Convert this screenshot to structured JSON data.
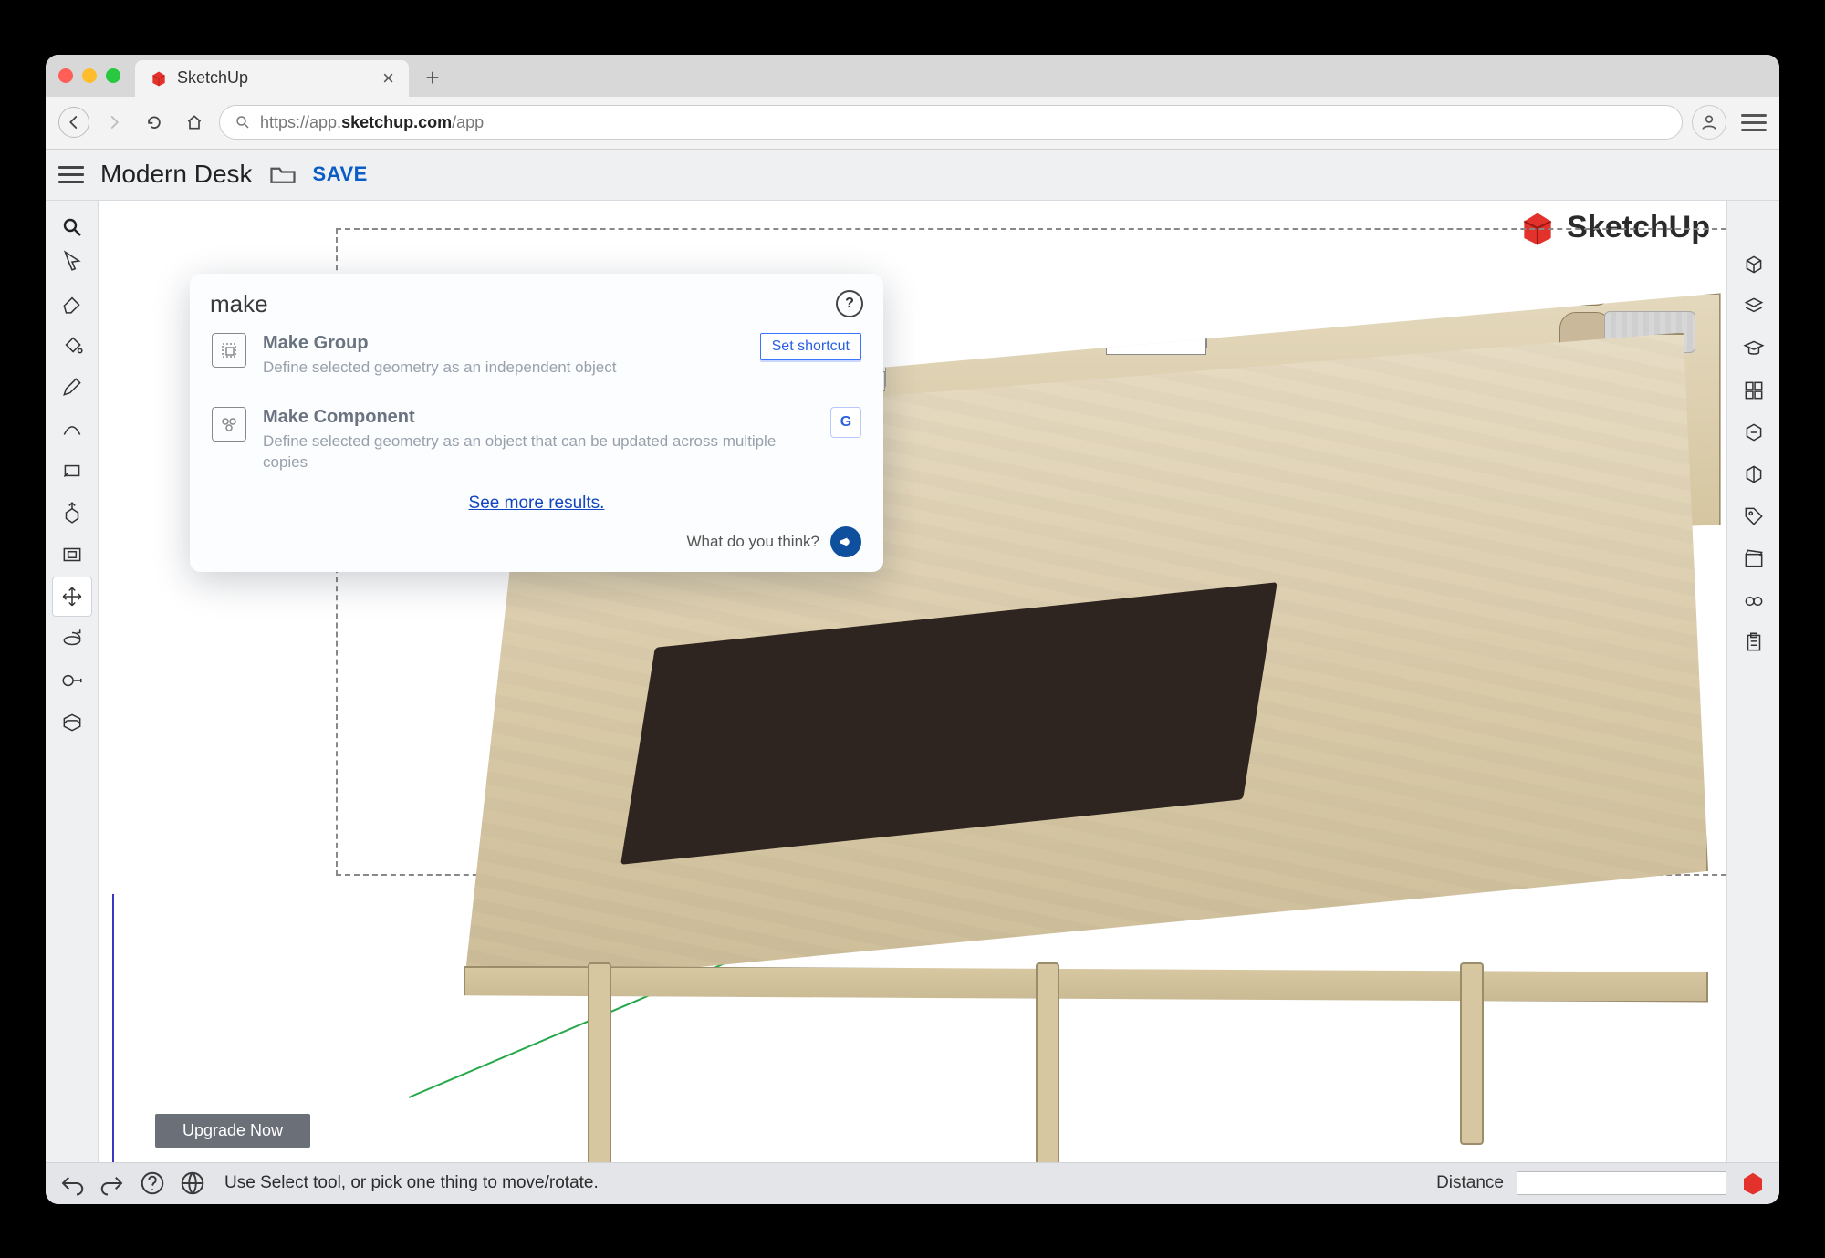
{
  "browser": {
    "tab_title": "SketchUp",
    "url_prefix": "https://app.",
    "url_bold": "sketchup.com",
    "url_suffix": "/app"
  },
  "header": {
    "title": "Modern Desk",
    "save": "SAVE"
  },
  "logo_text": "SketchUp",
  "search": {
    "query": "make",
    "results": [
      {
        "title": "Make Group",
        "desc": "Define selected geometry as an independent object",
        "action_label": "Set shortcut"
      },
      {
        "title": "Make Component",
        "desc": "Define selected geometry as an object that can be updated across multiple copies",
        "shortcut": "G"
      }
    ],
    "see_more": "See more results.",
    "feedback": "What do you think?"
  },
  "upgrade": "Upgrade Now",
  "status": {
    "message": "Use Select tool, or pick one thing to move/rotate.",
    "distance_label": "Distance"
  },
  "left_tool_names": [
    "select-tool",
    "eraser-tool",
    "paint-tool",
    "pencil-tool",
    "arc-tool",
    "rectangle-tool",
    "pushpull-tool",
    "offset-tool",
    "move-tool",
    "rotate-tool",
    "tape-tool",
    "section-tool"
  ],
  "right_panel_names": [
    "entity-info-panel",
    "layers-panel",
    "instructor-panel",
    "components-panel",
    "3dwarehouse-panel",
    "outliner-panel",
    "tags-panel",
    "scenes-panel",
    "display-panel",
    "softening-panel"
  ]
}
